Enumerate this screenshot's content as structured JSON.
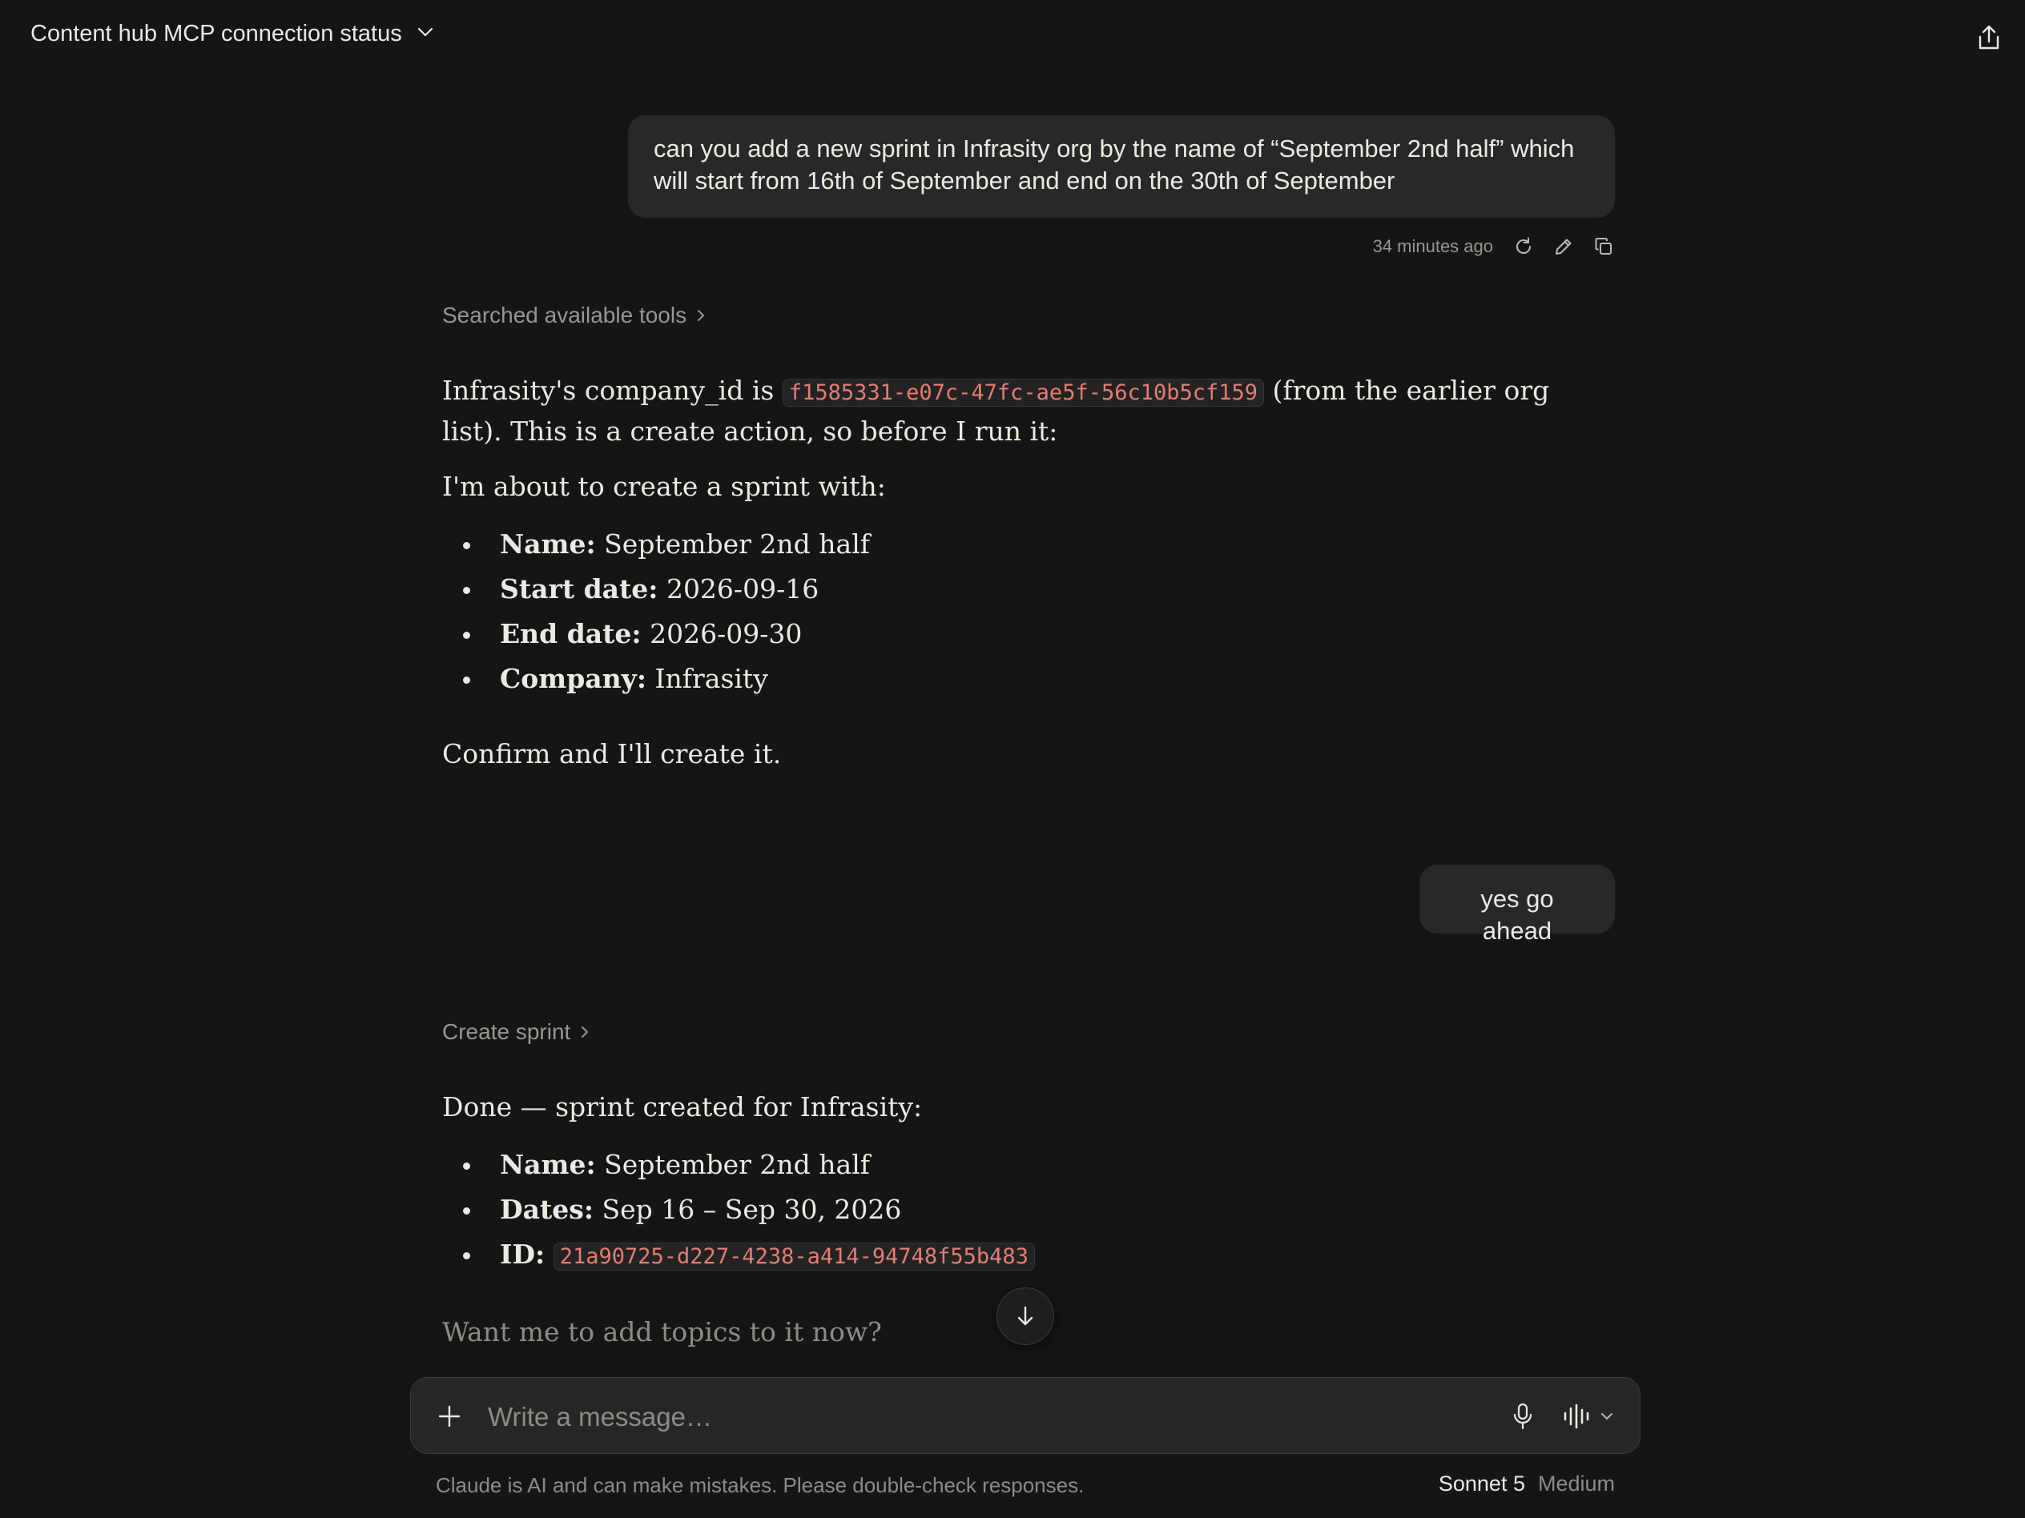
{
  "header": {
    "title": "Content hub MCP connection status"
  },
  "messages": {
    "user1": {
      "text": "can you add a new sprint in Infrasity org by the name of “September 2nd half” which will start from 16th of September and end on the 30th of September",
      "timestamp": "34 minutes ago"
    },
    "tool1": "Searched available tools",
    "assistant1": {
      "line1_before": "Infrasity's company_id is ",
      "company_id": "f1585331-e07c-47fc-ae5f-56c10b5cf159",
      "line1_after": " (from the earlier org list). This is a create action, so before I run it:",
      "intro": "I'm about to create a sprint with:",
      "items": [
        {
          "label": "Name:",
          "value": " September 2nd half"
        },
        {
          "label": "Start date:",
          "value": " 2026-09-16"
        },
        {
          "label": "End date:",
          "value": " 2026-09-30"
        },
        {
          "label": "Company:",
          "value": " Infrasity"
        }
      ],
      "outro": "Confirm and I'll create it."
    },
    "user2": {
      "text": "yes go ahead"
    },
    "tool2": "Create sprint",
    "assistant2": {
      "intro": "Done — sprint created for Infrasity:",
      "name_label": "Name:",
      "name_value": " September 2nd half",
      "dates_label": "Dates:",
      "dates_value": " Sep 16 – Sep 30, 2026",
      "id_label": "ID:",
      "id_value": "21a90725-d227-4238-a414-94748f55b483",
      "followup": "Want me to add topics to it now?"
    }
  },
  "composer": {
    "placeholder": "Write a message…"
  },
  "footer": {
    "disclaimer": "Claude is AI and can make mistakes. Please double-check responses.",
    "model": "Sonnet 5",
    "effort": "Medium"
  },
  "colors": {
    "background": "#151515",
    "bubble": "#282828",
    "code": "#e37d73",
    "muted": "#8f8b84"
  }
}
